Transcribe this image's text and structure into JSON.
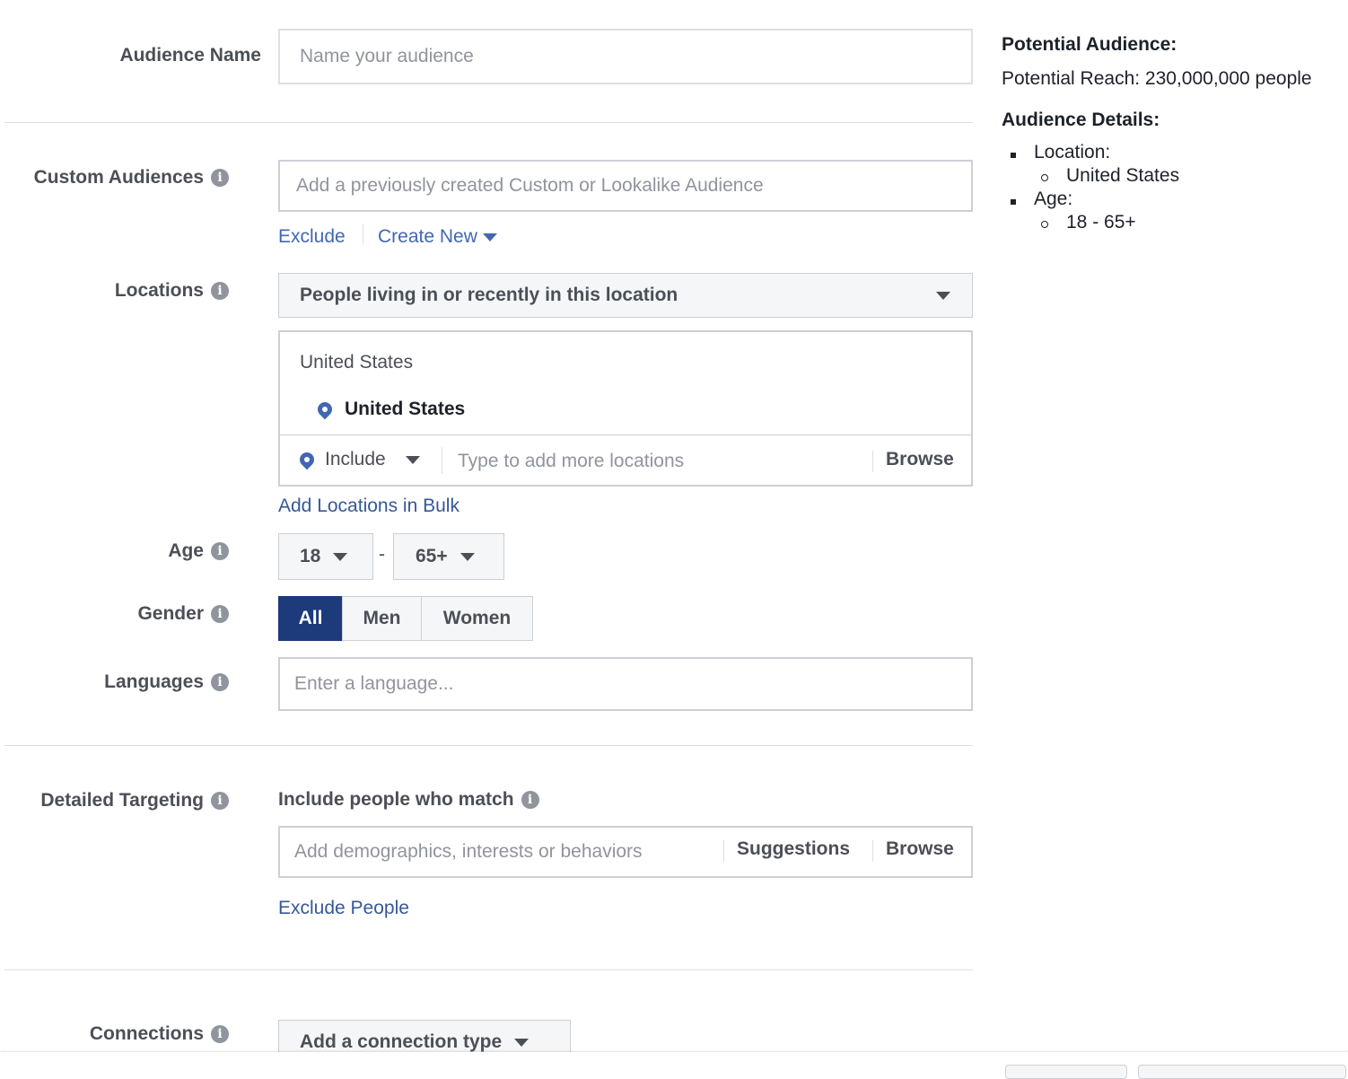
{
  "audience_name": {
    "label": "Audience Name",
    "placeholder": "Name your audience"
  },
  "custom_audiences": {
    "label": "Custom Audiences",
    "placeholder": "Add a previously created Custom or Lookalike Audience",
    "exclude_link": "Exclude",
    "create_new_link": "Create New"
  },
  "locations": {
    "label": "Locations",
    "dropdown_value": "People living in or recently in this location",
    "search_text": "United States",
    "selected_location": "United States",
    "include_label": "Include",
    "add_placeholder": "Type to add more locations",
    "browse_label": "Browse",
    "bulk_link": "Add Locations in Bulk"
  },
  "age": {
    "label": "Age",
    "min": "18",
    "separator": "-",
    "max": "65+"
  },
  "gender": {
    "label": "Gender",
    "options": [
      "All",
      "Men",
      "Women"
    ],
    "selected": "All"
  },
  "languages": {
    "label": "Languages",
    "placeholder": "Enter a language..."
  },
  "detailed_targeting": {
    "label": "Detailed Targeting",
    "heading": "Include people who match",
    "placeholder": "Add demographics, interests or behaviors",
    "suggestions_label": "Suggestions",
    "browse_label": "Browse",
    "exclude_link": "Exclude People"
  },
  "connections": {
    "label": "Connections",
    "dropdown_value": "Add a connection type"
  },
  "sidebar": {
    "potential_audience_title": "Potential Audience:",
    "potential_reach": "Potential Reach: 230,000,000 people",
    "details_title": "Audience Details:",
    "details": [
      {
        "key": "Location:",
        "value": "United States"
      },
      {
        "key": "Age:",
        "value": "18 - 65+"
      }
    ]
  },
  "info_glyph": "i",
  "colors": {
    "link": "#365899",
    "primary": "#1d3a7a",
    "muted": "#90949c"
  }
}
